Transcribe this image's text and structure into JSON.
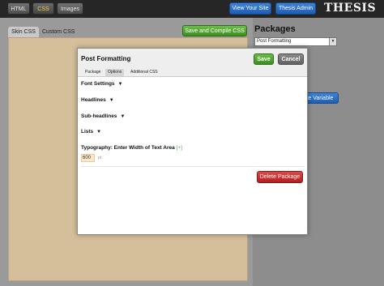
{
  "topbar": {
    "tabs": [
      {
        "label": "HTML",
        "active": false
      },
      {
        "label": "CSS",
        "active": true
      },
      {
        "label": "Images",
        "active": false
      }
    ],
    "view_site_label": "View Your Site",
    "admin_label": "Thesis Admin",
    "logo_text": "THESIS"
  },
  "editor_panel": {
    "tabs": [
      {
        "label": "Skin CSS",
        "active": true
      },
      {
        "label": "Custom CSS",
        "active": false
      }
    ],
    "save_compile_label": "Save and Compile CSS"
  },
  "packages_panel": {
    "title": "Packages",
    "selected_package": "Post Formatting",
    "variable_button_label": "ate Variable"
  },
  "modal": {
    "title": "Post Formatting",
    "save_label": "Save",
    "cancel_label": "Cancel",
    "tabs": [
      {
        "label": "Package",
        "active": false
      },
      {
        "label": "Options",
        "active": true
      },
      {
        "label": "Additional CSS",
        "active": false
      }
    ],
    "sections": [
      {
        "label": "Font Settings"
      },
      {
        "label": "Headlines"
      },
      {
        "label": "Sub-headlines"
      },
      {
        "label": "Lists"
      }
    ],
    "typography_label": "Typography: Enter Width of Text Area",
    "typography_plus": "[+]",
    "width_value": "600",
    "width_unit": "pt",
    "delete_label": "Delete Package"
  },
  "colors": {
    "accent_blue": "#2a6fc4",
    "save_green": "#4fa82e",
    "delete_red": "#c82828",
    "editor_bg": "#d5bf9b",
    "active_tab_text": "#f2d34a"
  }
}
